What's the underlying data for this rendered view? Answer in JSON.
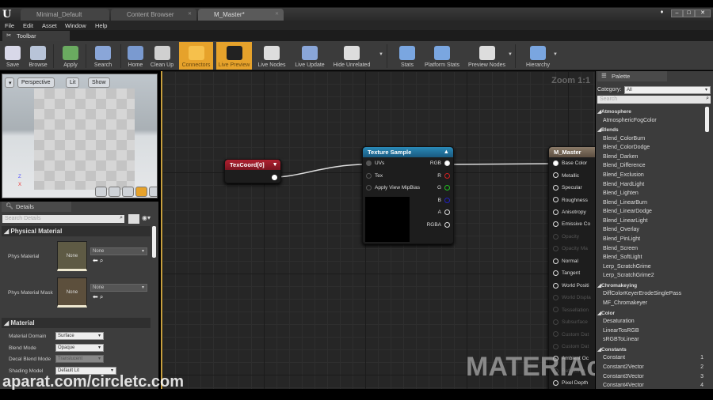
{
  "tabs": [
    {
      "label": "Minimal_Default"
    },
    {
      "label": "Content Browser"
    },
    {
      "label": "M_Master*"
    }
  ],
  "menu": [
    "File",
    "Edit",
    "Asset",
    "Window",
    "Help"
  ],
  "toolbar_tab": "Toolbar",
  "toolbar": [
    {
      "label": "Save",
      "active": false
    },
    {
      "label": "Browse",
      "active": false
    },
    {
      "label": "Apply",
      "active": false
    },
    {
      "label": "Search",
      "active": false
    },
    {
      "label": "Home",
      "active": false
    },
    {
      "label": "Clean Up",
      "active": false
    },
    {
      "label": "Connectors",
      "active": true
    },
    {
      "label": "Live Preview",
      "active": true
    },
    {
      "label": "Live Nodes",
      "active": false
    },
    {
      "label": "Live Update",
      "active": false
    },
    {
      "label": "Hide Unrelated",
      "active": false
    },
    {
      "label": "Stats",
      "active": false
    },
    {
      "label": "Platform Stats",
      "active": false
    },
    {
      "label": "Preview Nodes",
      "active": false
    },
    {
      "label": "Hierarchy",
      "active": false
    }
  ],
  "viewport": {
    "perspective": "Perspective",
    "lit": "Lit",
    "show": "Show",
    "axis_z": "Z",
    "axis_x": "X"
  },
  "details": {
    "tab": "Details",
    "search_placeholder": "Search Details",
    "physical_material": {
      "header": "Physical Material",
      "phys_material": "Phys Material",
      "phys_material_mask": "Phys Material Mask",
      "none": "None"
    },
    "material": {
      "header": "Material",
      "rows": [
        {
          "label": "Material Domain",
          "value": "Surface"
        },
        {
          "label": "Blend Mode",
          "value": "Opaque"
        },
        {
          "label": "Decal Blend Mode",
          "value": "Translucent"
        },
        {
          "label": "Shading Model",
          "value": "Default Lit"
        }
      ]
    }
  },
  "graph": {
    "zoom": "Zoom 1:1",
    "texcoord": {
      "title": "TexCoord[0]"
    },
    "texture_sample": {
      "title": "Texture Sample",
      "inputs": [
        "UVs",
        "Tex",
        "Apply View MipBias"
      ],
      "outputs": [
        "RGB",
        "R",
        "G",
        "B",
        "A",
        "RGBA"
      ]
    },
    "master": {
      "title": "M_Master",
      "pins": [
        {
          "label": "Base Color",
          "enabled": true
        },
        {
          "label": "Metallic",
          "enabled": true
        },
        {
          "label": "Specular",
          "enabled": true
        },
        {
          "label": "Roughness",
          "enabled": true
        },
        {
          "label": "Anisotropy",
          "enabled": true
        },
        {
          "label": "Emissive Co",
          "enabled": true
        },
        {
          "label": "Opacity",
          "enabled": false
        },
        {
          "label": "Opacity Ma",
          "enabled": false
        },
        {
          "label": "Normal",
          "enabled": true
        },
        {
          "label": "Tangent",
          "enabled": true
        },
        {
          "label": "World Positi",
          "enabled": true
        },
        {
          "label": "World Displa",
          "enabled": false
        },
        {
          "label": "Tessellation",
          "enabled": false
        },
        {
          "label": "Subsurface",
          "enabled": false
        },
        {
          "label": "Custom Dat",
          "enabled": false
        },
        {
          "label": "Custom Dat",
          "enabled": false
        },
        {
          "label": "Ambient Oc",
          "enabled": true
        },
        {
          "label": "Refraction",
          "enabled": false
        },
        {
          "label": "Pixel Depth",
          "enabled": true
        }
      ]
    },
    "pin_colors": {
      "R": "#d02020",
      "G": "#20c020",
      "B": "#2020c0"
    }
  },
  "palette": {
    "tab": "Palette",
    "category_label": "Category:",
    "category_value": "All",
    "search_placeholder": "Search",
    "items": [
      {
        "label": "Atmosphere",
        "cat": true
      },
      {
        "label": "AtmosphericFogColor"
      },
      {
        "label": "Blends",
        "cat": true
      },
      {
        "label": "Blend_ColorBurn"
      },
      {
        "label": "Blend_ColorDodge"
      },
      {
        "label": "Blend_Darken"
      },
      {
        "label": "Blend_Difference"
      },
      {
        "label": "Blend_Exclusion"
      },
      {
        "label": "Blend_HardLight"
      },
      {
        "label": "Blend_Lighten"
      },
      {
        "label": "Blend_LinearBurn"
      },
      {
        "label": "Blend_LinearDodge"
      },
      {
        "label": "Blend_LinearLight"
      },
      {
        "label": "Blend_Overlay"
      },
      {
        "label": "Blend_PinLight"
      },
      {
        "label": "Blend_Screen"
      },
      {
        "label": "Blend_SoftLight"
      },
      {
        "label": "Lerp_ScratchGrime"
      },
      {
        "label": "Lerp_ScratchGrime2"
      },
      {
        "label": "Chromakeying",
        "cat": true
      },
      {
        "label": "DiffColorKeyerErodeSinglePass"
      },
      {
        "label": "MF_Chromakeyer"
      },
      {
        "label": "Color",
        "cat": true
      },
      {
        "label": "Desaturation"
      },
      {
        "label": "LinearTosRGB"
      },
      {
        "label": "sRGBToLinear"
      },
      {
        "label": "Constants",
        "cat": true
      },
      {
        "label": "Constant",
        "key": "1"
      },
      {
        "label": "Constant2Vector",
        "key": "2"
      },
      {
        "label": "Constant3Vector",
        "key": "3"
      },
      {
        "label": "Constant4Vector",
        "key": "4"
      }
    ]
  },
  "watermarks": {
    "bottom_left": "aparat.com/circletc.com",
    "graph": "MATERIAcircletc.com"
  },
  "accent": "#e6a22b"
}
